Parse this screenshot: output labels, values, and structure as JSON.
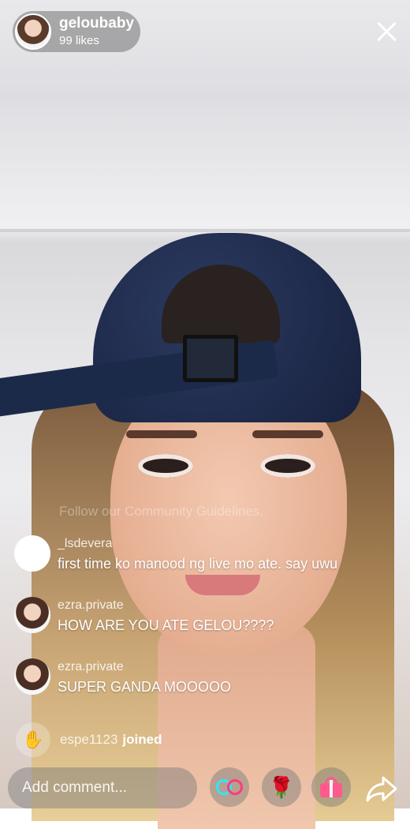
{
  "header": {
    "host_name": "geloubaby",
    "likes": "99 likes"
  },
  "guideline": "Follow our Community Guidelines.",
  "comments": [
    {
      "user": "_lsdevera",
      "text": "first time ko manood ng live mo ate. say uwu"
    },
    {
      "user": "ezra.private",
      "text": "HOW ARE YOU ATE GELOU????"
    },
    {
      "user": "ezra.private",
      "text": "SUPER GANDA MOOOOO"
    }
  ],
  "joined": {
    "user": "espe1123",
    "word": "joined"
  },
  "bottom": {
    "comment_placeholder": "Add comment...",
    "icons": [
      "loop-icon",
      "rose-icon",
      "gift-icon",
      "share-icon"
    ]
  }
}
